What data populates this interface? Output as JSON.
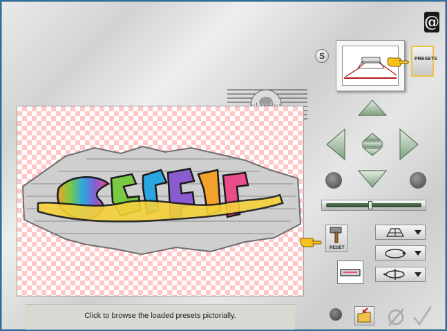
{
  "window": {
    "brand_glyph": "@"
  },
  "controls": {
    "s_button_label": "S",
    "presets_button_label": "PRESETS",
    "reset_button_label": "RESET"
  },
  "preview": {
    "artwork_description_hidden": ""
  },
  "watermark": {
    "text": "claudia"
  },
  "status_bar": {
    "message": "Click to browse the loaded presets pictorially."
  },
  "colors": {
    "accent_yellow": "#f0c24a",
    "checker_pink": "#ffc7c7",
    "nav_green": "#8fb08f"
  },
  "icons": {
    "mode_buttons": [
      "grid-perspective-icon",
      "rotate-circle-icon",
      "flip-axis-icon"
    ]
  }
}
